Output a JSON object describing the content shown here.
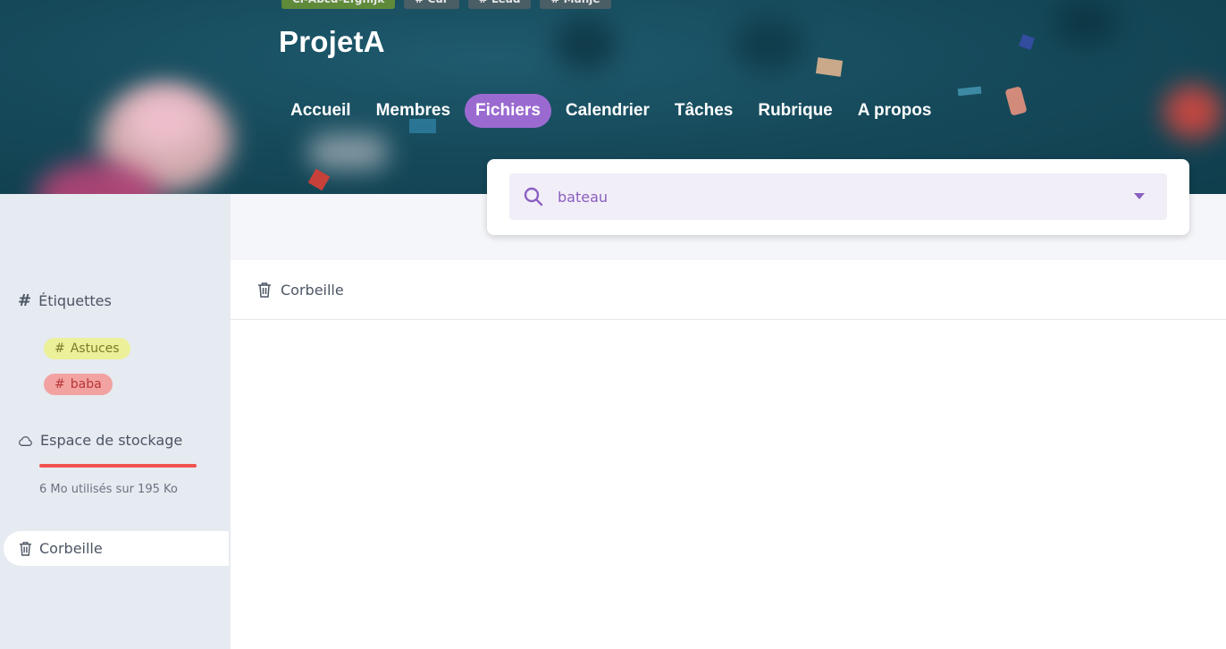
{
  "header": {
    "tags": [
      "Cl-Abcd-Efghijk",
      "# Cur",
      "# Lead",
      "# Manje"
    ],
    "project_title": "ProjetA",
    "nav": [
      {
        "label": "Accueil",
        "active": false
      },
      {
        "label": "Membres",
        "active": false
      },
      {
        "label": "Fichiers",
        "active": true
      },
      {
        "label": "Calendrier",
        "active": false
      },
      {
        "label": "Tâches",
        "active": false
      },
      {
        "label": "Rubrique",
        "active": false
      },
      {
        "label": "A propos",
        "active": false
      }
    ]
  },
  "search": {
    "value": "bateau",
    "icon": "search-icon",
    "accent_color": "#8a5fc0"
  },
  "sidebar": {
    "labels_heading": "Étiquettes",
    "labels": [
      {
        "name": "Astuces",
        "color": "#ecf098"
      },
      {
        "name": "baba",
        "color": "#f2a3a1"
      }
    ],
    "storage_heading": "Espace de stockage",
    "storage_text": "6 Mo utilisés sur 195 Ko",
    "storage_fill_fraction": 1.0,
    "storage_color": "#f1514f",
    "trash_label": "Corbeille"
  },
  "main": {
    "breadcrumb_label": "Corbeille"
  },
  "colors": {
    "nav_active": "#9a6ad0",
    "banner": "#164b5c"
  }
}
